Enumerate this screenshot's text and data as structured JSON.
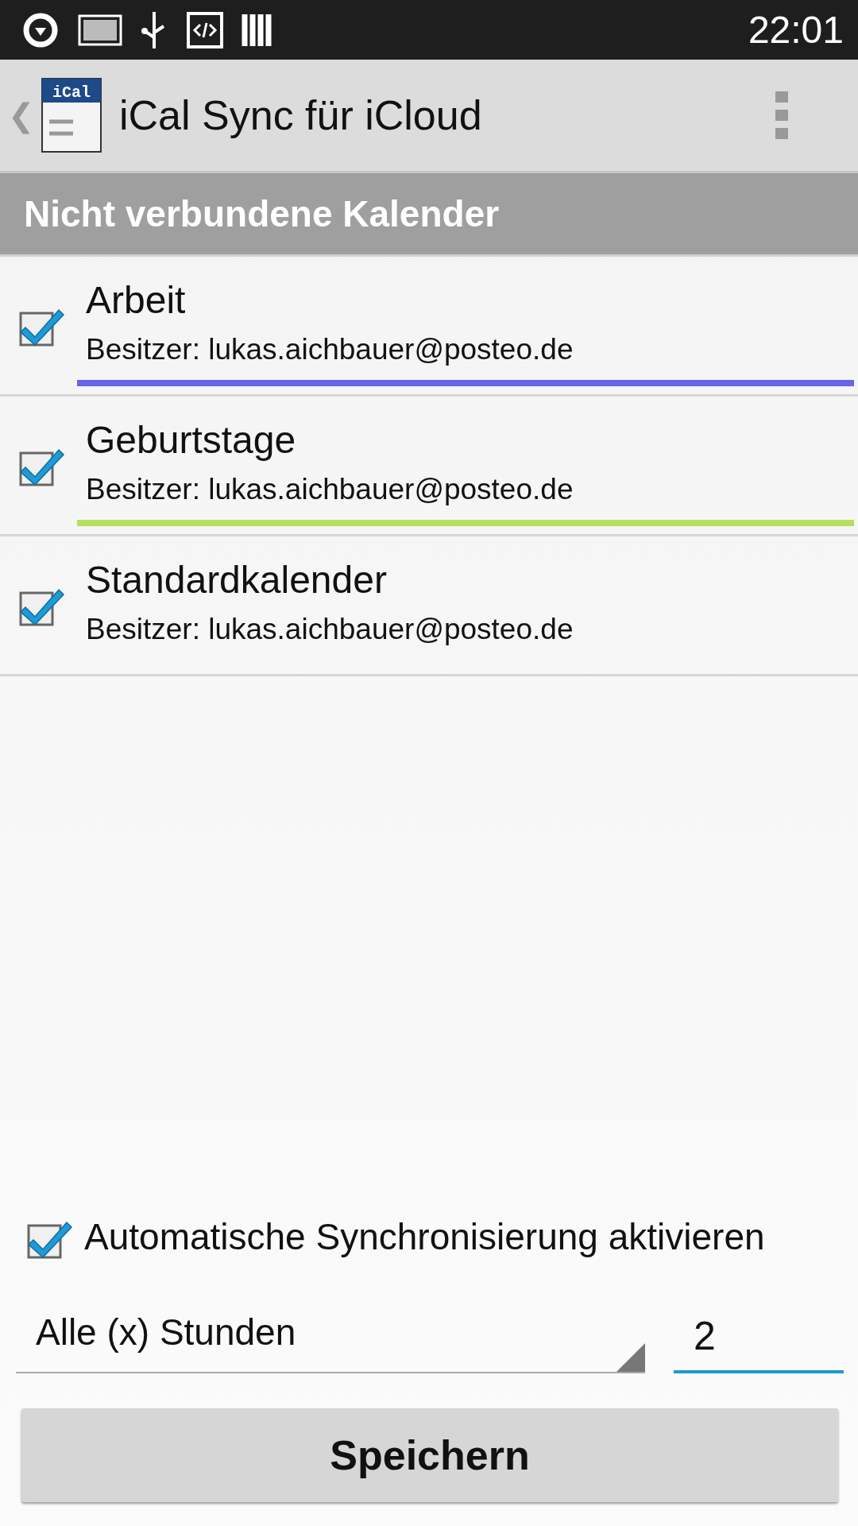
{
  "status_bar": {
    "time": "22:01"
  },
  "app_bar": {
    "back": "❮",
    "title": "iCal Sync für iCloud",
    "logo_text": "iCal"
  },
  "section": {
    "title": "Nicht verbundene Kalender"
  },
  "calendars": [
    {
      "name": "Arbeit",
      "owner": "Besitzer: lukas.aichbauer@posteo.de",
      "checked": true,
      "color": "#6666e6"
    },
    {
      "name": "Geburtstage",
      "owner": "Besitzer: lukas.aichbauer@posteo.de",
      "checked": true,
      "color": "#b5e061"
    },
    {
      "name": "Standardkalender",
      "owner": "Besitzer: lukas.aichbauer@posteo.de",
      "checked": true
    }
  ],
  "auto_sync": {
    "label": "Automatische Synchronisierung aktivieren",
    "checked": true
  },
  "interval": {
    "label": "Alle (x) Stunden",
    "value": "2"
  },
  "save_button": {
    "label": "Speichern"
  }
}
